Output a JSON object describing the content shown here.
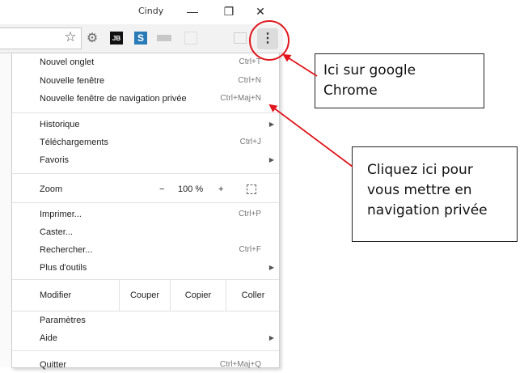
{
  "window": {
    "user_name": "Cindy",
    "minimize_glyph": "—",
    "restore_glyph": "❐",
    "close_glyph": "✕"
  },
  "toolbar": {
    "star_glyph": "☆",
    "ext_gear_glyph": "⚙",
    "ext_jb_label": "JB",
    "ext_s_label": "S",
    "menu_glyph": "⋮"
  },
  "menu": {
    "new_tab": {
      "label": "Nouvel onglet",
      "shortcut": "Ctrl+T"
    },
    "new_window": {
      "label": "Nouvelle fenêtre",
      "shortcut": "Ctrl+N"
    },
    "new_private": {
      "label": "Nouvelle fenêtre de navigation privée",
      "shortcut": "Ctrl+Maj+N"
    },
    "history": {
      "label": "Historique"
    },
    "downloads": {
      "label": "Téléchargements",
      "shortcut": "Ctrl+J"
    },
    "bookmarks": {
      "label": "Favoris"
    },
    "zoom": {
      "label": "Zoom",
      "minus": "−",
      "value": "100 %",
      "plus": "+"
    },
    "print": {
      "label": "Imprimer...",
      "shortcut": "Ctrl+P"
    },
    "cast": {
      "label": "Caster..."
    },
    "find": {
      "label": "Rechercher...",
      "shortcut": "Ctrl+F"
    },
    "more_tools": {
      "label": "Plus d'outils"
    },
    "edit": {
      "label": "Modifier",
      "cut": "Couper",
      "copy": "Copier",
      "paste": "Coller"
    },
    "settings": {
      "label": "Paramètres"
    },
    "help": {
      "label": "Aide"
    },
    "quit": {
      "label": "Quitter",
      "shortcut": "Ctrl+Maj+Q"
    },
    "submenu_arrow": "▶"
  },
  "annotations": {
    "callout_1_line1": "Ici sur google",
    "callout_1_line2": "Chrome",
    "callout_2_line1": "Cliquez ici pour",
    "callout_2_line2": "vous mettre en",
    "callout_2_line3": "navigation privée",
    "accent_color": "#e0161c"
  }
}
